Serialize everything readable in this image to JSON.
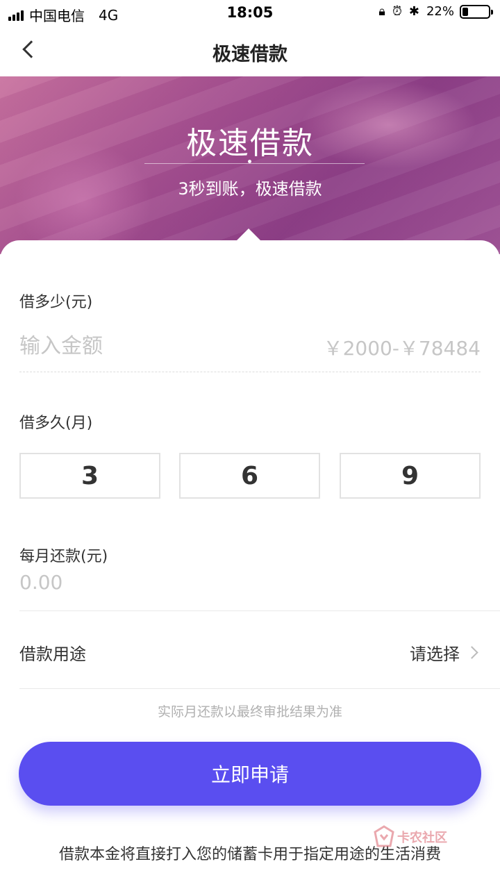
{
  "status_bar": {
    "carrier": "中国电信",
    "network": "4G",
    "time": "18:05",
    "battery": "22%",
    "battery_level": 0.22,
    "icons": [
      "signal-icon",
      "orientation-lock-icon",
      "alarm-icon",
      "bluetooth-icon",
      "battery-icon"
    ]
  },
  "nav": {
    "title": "极速借款",
    "back_icon": "back-arrow-icon"
  },
  "banner": {
    "title": "极速借款",
    "subtitle": "3秒到账，极速借款"
  },
  "form": {
    "amount": {
      "label": "借多少(元)",
      "placeholder": "输入金额",
      "value": "",
      "range": "￥2000-￥78484"
    },
    "term": {
      "label": "借多久(月)",
      "options": [
        "3",
        "6",
        "9"
      ]
    },
    "monthly": {
      "label": "每月还款(元)",
      "value": "0.00"
    },
    "purpose": {
      "label": "借款用途",
      "value": "请选择",
      "icon": "chevron-right-icon"
    }
  },
  "disclaimer": "实际月还款以最终审批结果为准",
  "apply_button": "立即申请",
  "footer_note": "借款本金将直接打入您的储蓄卡用于指定用途的生活消费",
  "watermark": {
    "text": "卡农社区"
  },
  "colors": {
    "accent": "#5a4ef0",
    "banner": "#9b4a8c",
    "placeholder": "#c6c6c6",
    "border": "#e2e2e2"
  }
}
